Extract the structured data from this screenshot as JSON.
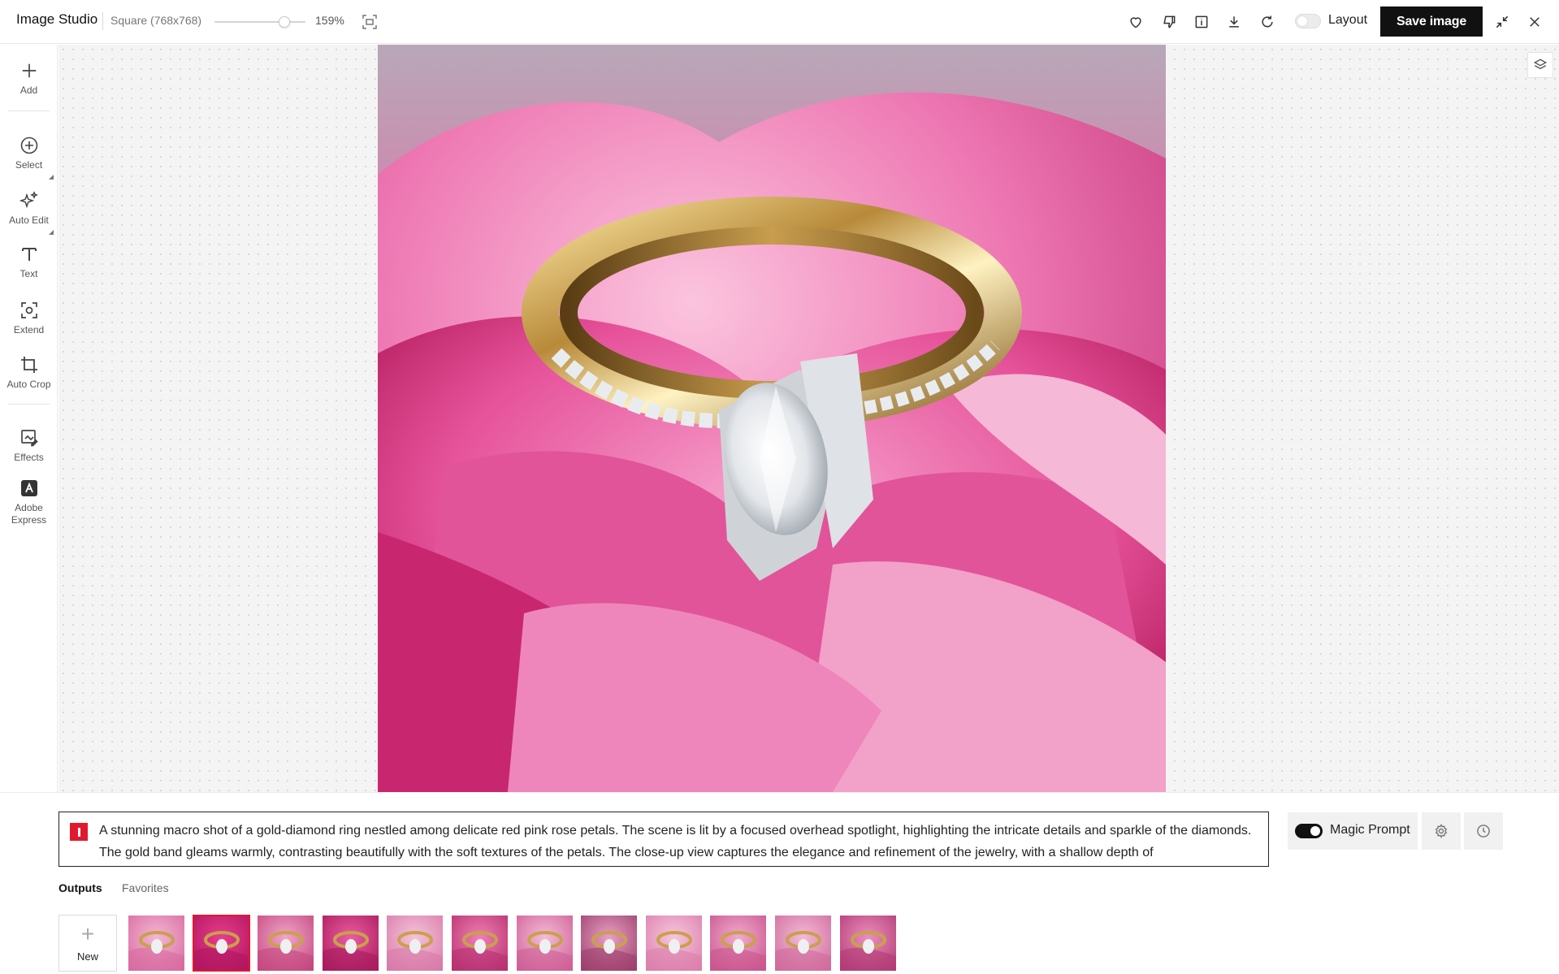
{
  "header": {
    "app_title": "Image Studio",
    "canvas_size": "Square (768x768)",
    "zoom_value": "159%",
    "zoom_level_fraction": 0.77,
    "layout_toggle": {
      "label": "Layout",
      "on": false
    },
    "save_button": "Save image",
    "icons": [
      "heart-icon",
      "thumbs-down-icon",
      "info-icon",
      "download-icon",
      "refresh-icon",
      "collapse-icon",
      "close-icon"
    ]
  },
  "toolbar": {
    "items": [
      {
        "label": "Add",
        "icon": "plus-icon"
      },
      {
        "label": "Select",
        "icon": "select-target-icon"
      },
      {
        "label": "Auto Edit",
        "icon": "sparkles-icon"
      },
      {
        "label": "Text",
        "icon": "text-t-icon"
      },
      {
        "label": "Extend",
        "icon": "extend-frame-icon"
      },
      {
        "label": "Auto Crop",
        "icon": "crop-icon"
      },
      {
        "label": "Effects",
        "icon": "effects-icon"
      },
      {
        "label": "Adobe\nExpress",
        "icon": "adobe-express-icon"
      }
    ]
  },
  "canvas": {
    "image_description_icon": "layers-icon"
  },
  "prompt": {
    "text": "A stunning macro shot of a gold-diamond ring nestled among delicate red pink rose petals. The scene is lit by a focused overhead spotlight, highlighting the intricate details and sparkle of the diamonds. The gold band gleams warmly, contrasting beautifully with the soft textures of the petals. The close-up view captures the elegance and refinement of the jewelry, with a shallow depth of",
    "magic_prompt": {
      "label": "Magic Prompt",
      "on": true
    },
    "accent_color": "#e0192f"
  },
  "outputs": {
    "tabs": [
      "Outputs",
      "Favorites"
    ],
    "active_tab": "Outputs",
    "new_label": "New",
    "thumbnail_count": 12,
    "selected_index": 1
  }
}
